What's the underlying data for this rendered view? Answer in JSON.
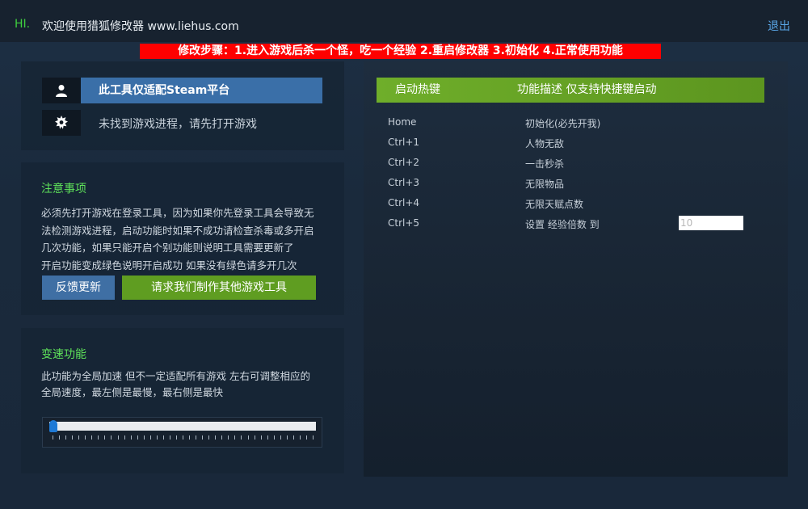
{
  "titlebar": {
    "hi": "HI.",
    "title": "欢迎使用猎狐修改器 www.liehus.com",
    "logout": "退出"
  },
  "banner": "修改步骤：1.进入游戏后杀一个怪，吃一个经验 2.重启修改器 3.初始化 4.正常使用功能",
  "platform": {
    "steam_label": "此工具仅适配Steam平台",
    "process_status": "未找到游戏进程，请先打开游戏"
  },
  "notice": {
    "title": "注意事项",
    "lines": [
      "必须先打开游戏在登录工具，因为如果你先登录工具会导致无",
      "法检测游戏进程，启动功能时如果不成功请检查杀毒或多开启",
      "几次功能，如果只能开启个别功能则说明工具需要更新了",
      "开启功能变成绿色说明开启成功 如果没有绿色请多开几次"
    ],
    "feedback_button": "反馈更新",
    "request_button": "请求我们制作其他游戏工具"
  },
  "speed": {
    "title": "变速功能",
    "lines": [
      "此功能为全局加速 但不一定适配所有游戏 左右可调整相应的",
      "全局速度，最左侧是最慢，最右侧是最快"
    ],
    "slider_value": 0
  },
  "hotkeys": {
    "header_key": "启动热键",
    "header_desc": "功能描述 仅支持快捷键启动",
    "rows": [
      {
        "key": "Home",
        "desc": "初始化(必先开我)"
      },
      {
        "key": "Ctrl+1",
        "desc": "人物无敌"
      },
      {
        "key": "Ctrl+2",
        "desc": "一击秒杀"
      },
      {
        "key": "Ctrl+3",
        "desc": "无限物品"
      },
      {
        "key": "Ctrl+4",
        "desc": "无限天赋点数"
      },
      {
        "key": "Ctrl+5",
        "desc": "设置 经验倍数 到"
      }
    ],
    "exp_input_placeholder": "10"
  },
  "colors": {
    "accent_green": "#5fe35a",
    "banner_red": "#ff0000",
    "steam_blue": "#3a6fa8",
    "button_green": "#5f9d21",
    "link_blue": "#5aa7e8"
  }
}
